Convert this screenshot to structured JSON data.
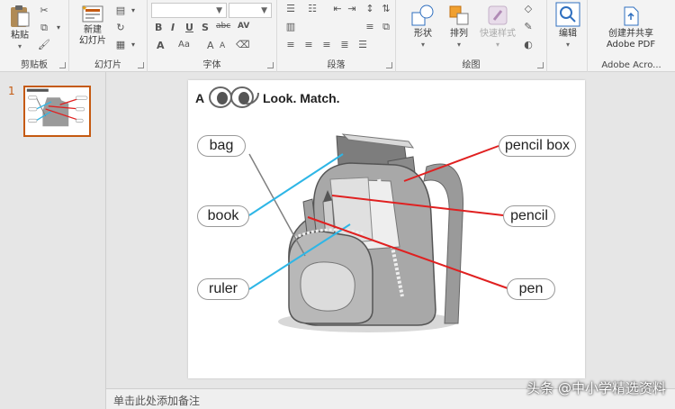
{
  "ribbon": {
    "clipboard": {
      "paste": "粘贴",
      "group": "剪贴板"
    },
    "slides": {
      "new_slide": "新建\n幻灯片",
      "new_slide_line1": "新建",
      "new_slide_line2": "幻灯片",
      "group": "幻灯片"
    },
    "font": {
      "group": "字体",
      "bold": "B",
      "italic": "I",
      "underline": "U",
      "shadow": "S",
      "strike": "abc",
      "spacing": "AV",
      "grow": "A",
      "shrink": "Aa",
      "color": "A"
    },
    "paragraph": {
      "group": "段落"
    },
    "drawing": {
      "shape": "形状",
      "arrange": "排列",
      "quick_styles": "快速样式",
      "group": "绘图"
    },
    "editing": {
      "edit": "编辑"
    },
    "adobe": {
      "create_share_line1": "创建并共享",
      "create_share_line2": "Adobe PDF",
      "group": "Adobe Acro..."
    }
  },
  "slides_pane": {
    "slide_number": "1"
  },
  "slide": {
    "title_prefix": "A",
    "title": "Look. Match.",
    "labels": [
      "bag",
      "book",
      "ruler",
      "pencil box",
      "pencil",
      "pen"
    ]
  },
  "notes": {
    "placeholder": "单击此处添加备注"
  },
  "watermark": "头条 @中小学精选资料",
  "colors": {
    "accent": "#c55a11",
    "blue_line": "#2eb6e6",
    "red_line": "#e02020"
  }
}
